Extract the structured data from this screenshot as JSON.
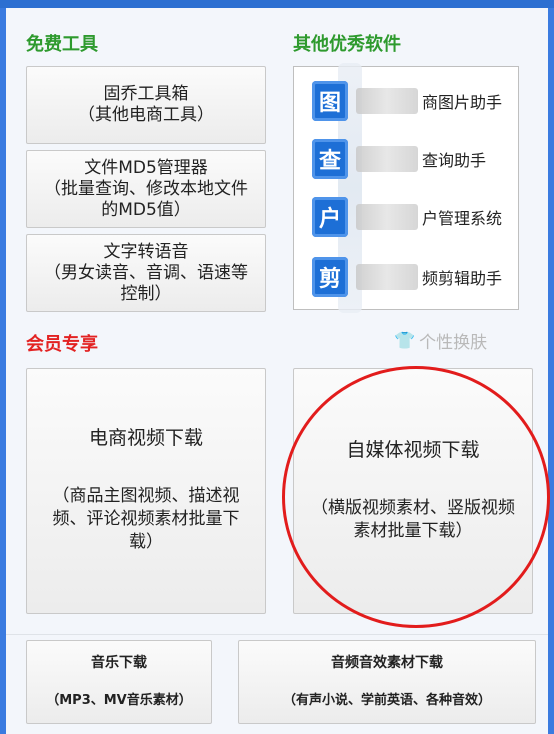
{
  "sections": {
    "free_tools": "免费工具",
    "other_software": "其他优秀软件",
    "member_only": "会员专享"
  },
  "free_buttons": [
    {
      "title": "固乔工具箱",
      "sub": "（其他电商工具）"
    },
    {
      "title": "文件MD5管理器",
      "sub": "（批量查询、修改本地文件的MD5值）"
    },
    {
      "title": "文字转语音",
      "sub": "（男女读音、音调、语速等控制）"
    }
  ],
  "software_items": [
    {
      "icon": "图",
      "label": "商图片助手"
    },
    {
      "icon": "查",
      "label": "查询助手"
    },
    {
      "icon": "户",
      "label": "户管理系统"
    },
    {
      "icon": "剪",
      "label": "频剪辑助手"
    }
  ],
  "skin": {
    "label": "个性换肤",
    "icon": "shirt-icon"
  },
  "member_buttons": [
    {
      "title": "电商视频下载",
      "sub": "（商品主图视频、描述视频、评论视频素材批量下载）"
    },
    {
      "title": "自媒体视频下载",
      "sub": "（横版视频素材、竖版视频素材批量下载）"
    }
  ],
  "bottom_buttons": [
    {
      "title": "音乐下载",
      "sub": "（MP3、MV音乐素材）"
    },
    {
      "title": "音频音效素材下载",
      "sub": "（有声小说、学前英语、各种音效）"
    }
  ],
  "colors": {
    "section_green": "#2e9a2e",
    "section_red": "#e32222",
    "highlight_circle": "#e21c1c",
    "title_bar": "#2c6fd1"
  }
}
